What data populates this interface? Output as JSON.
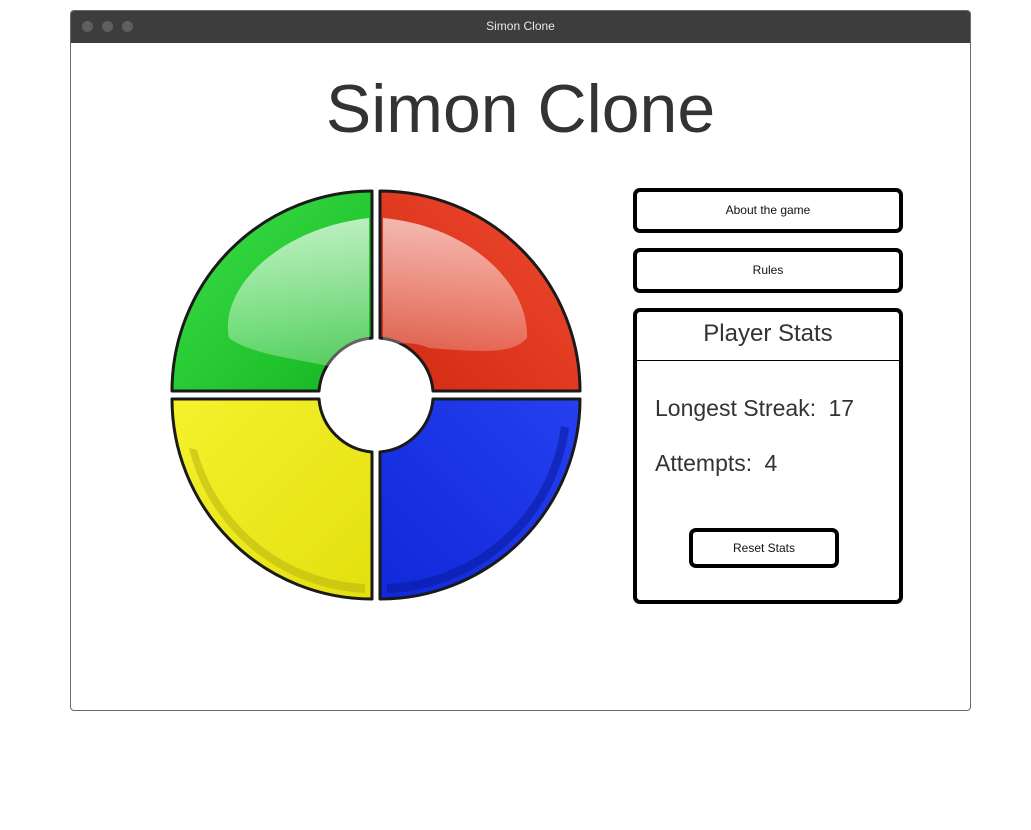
{
  "window": {
    "title": "Simon Clone"
  },
  "header": {
    "title": "Simon Clone"
  },
  "board": {
    "pads": [
      {
        "name": "green",
        "color": "#1ecf2c"
      },
      {
        "name": "red",
        "color": "#e0321a"
      },
      {
        "name": "yellow",
        "color": "#f1ee1f"
      },
      {
        "name": "blue",
        "color": "#1635e8"
      }
    ]
  },
  "menu": {
    "about_label": "About the game",
    "rules_label": "Rules"
  },
  "stats": {
    "heading": "Player Stats",
    "longest_streak_label": "Longest Streak:",
    "longest_streak_value": "17",
    "attempts_label": "Attempts:",
    "attempts_value": "4",
    "reset_label": "Reset Stats"
  }
}
